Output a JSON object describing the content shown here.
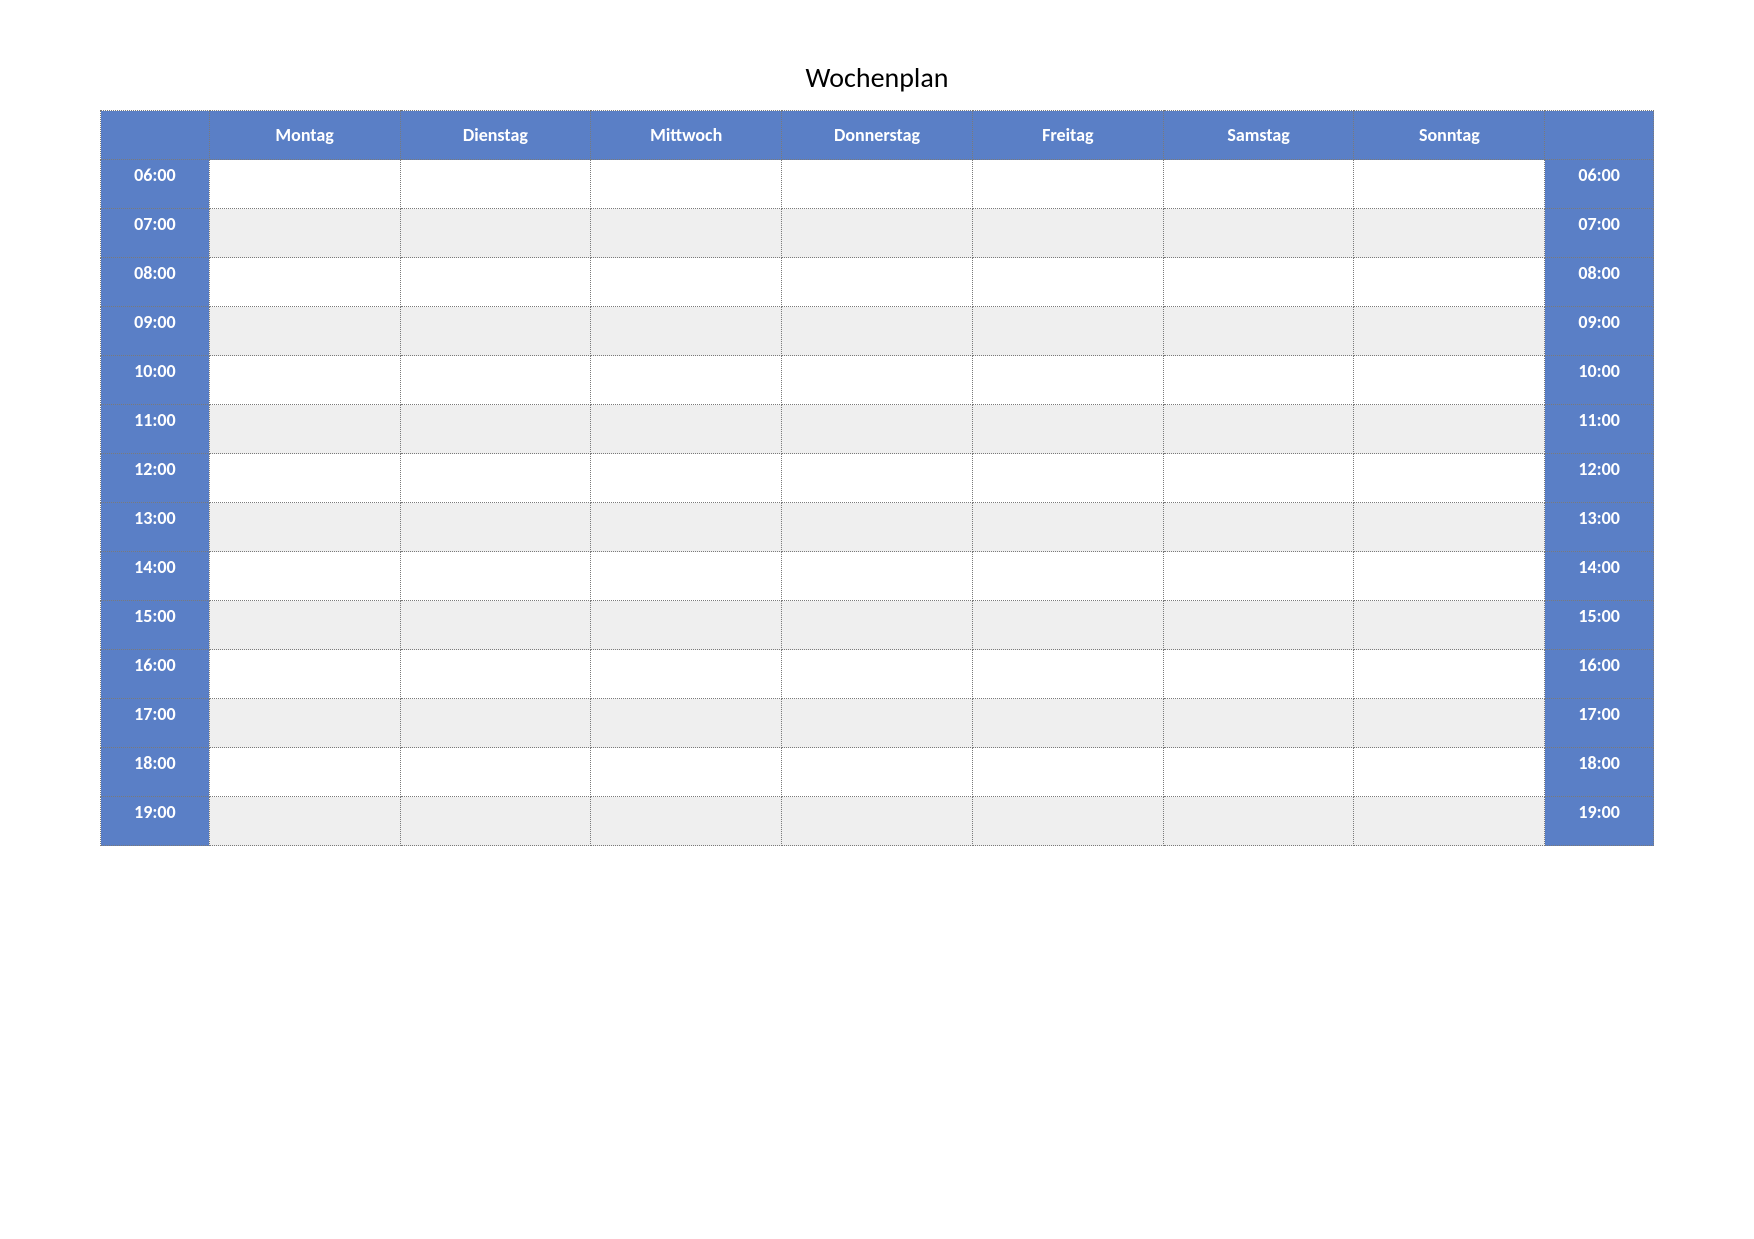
{
  "title": "Wochenplan",
  "days": [
    "Montag",
    "Dienstag",
    "Mittwoch",
    "Donnerstag",
    "Freitag",
    "Samstag",
    "Sonntag"
  ],
  "times": [
    "06:00",
    "07:00",
    "08:00",
    "09:00",
    "10:00",
    "11:00",
    "12:00",
    "13:00",
    "14:00",
    "15:00",
    "16:00",
    "17:00",
    "18:00",
    "19:00"
  ]
}
